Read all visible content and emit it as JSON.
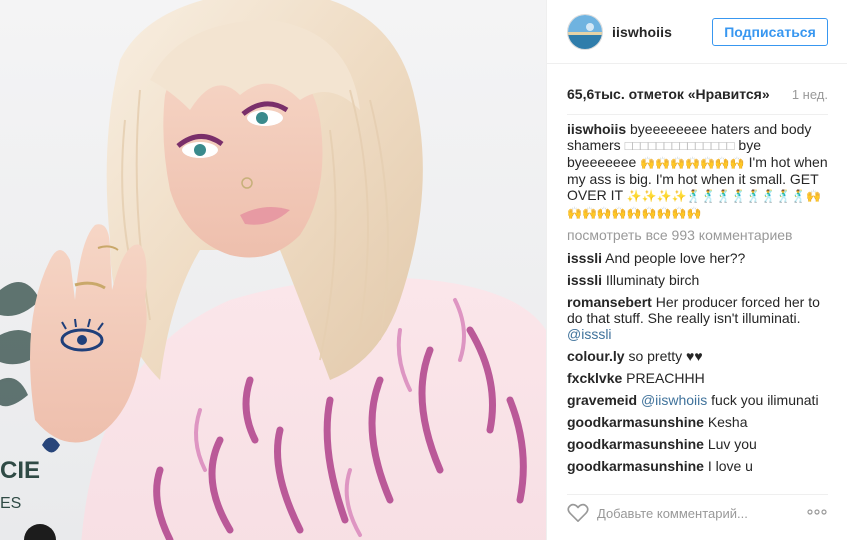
{
  "post": {
    "photo_alt": "Фото пользователя iiswhoiis",
    "photo_corner_text_1": "CIE",
    "photo_corner_text_2": "ES"
  },
  "header": {
    "username": "iiswhoiis",
    "follow_label": "Подписаться"
  },
  "meta": {
    "likes": "65,6тыс. отметок «Нравится»",
    "time_ago": "1 нед."
  },
  "caption": {
    "user": "iiswhoiis",
    "text_1": "byeeeeeeee haters and body shamers",
    "boxes": "□□□□□□□□□□□□□□",
    "text_2": "bye byeeeeeee",
    "emoji_run_1": "🙌🙌🙌🙌🙌🙌🙌",
    "text_3": "I'm hot when my ass is big. I'm hot when it small. GET OVER IT",
    "emoji_run_2": "✨✨✨✨🕺🕺🕺🕺🕺🕺🕺🕺🙌🙌🙌🙌🙌🙌🙌🙌🙌🙌"
  },
  "view_all_label": "посмотреть все 993 комментариев",
  "comments": [
    {
      "user": "isssli",
      "text": "And people love her??"
    },
    {
      "user": "isssli",
      "text": "Illuminaty birch"
    },
    {
      "user": "romansebert",
      "text": "Her producer forced her to do that stuff. She really isn't illuminati.",
      "mention": "@isssli"
    },
    {
      "user": "colour.ly",
      "text": "so pretty ♥♥"
    },
    {
      "user": "fxcklvke",
      "text": "PREACHHH"
    },
    {
      "user": "gravemeid",
      "mention_first": "@iiswhoiis",
      "text": "fuck you ilimunati"
    },
    {
      "user": "goodkarmasunshine",
      "text": "Kesha"
    },
    {
      "user": "goodkarmasunshine",
      "text": "Luv you"
    },
    {
      "user": "goodkarmasunshine",
      "text": "I love u"
    }
  ],
  "add_comment": {
    "placeholder": "Добавьте комментарий..."
  },
  "icons": {
    "like": "heart-outline-icon",
    "more": "more-dots-icon"
  },
  "colors": {
    "accent": "#3897f0",
    "mention": "#3f729b",
    "muted": "#999999",
    "border": "#efefef"
  }
}
